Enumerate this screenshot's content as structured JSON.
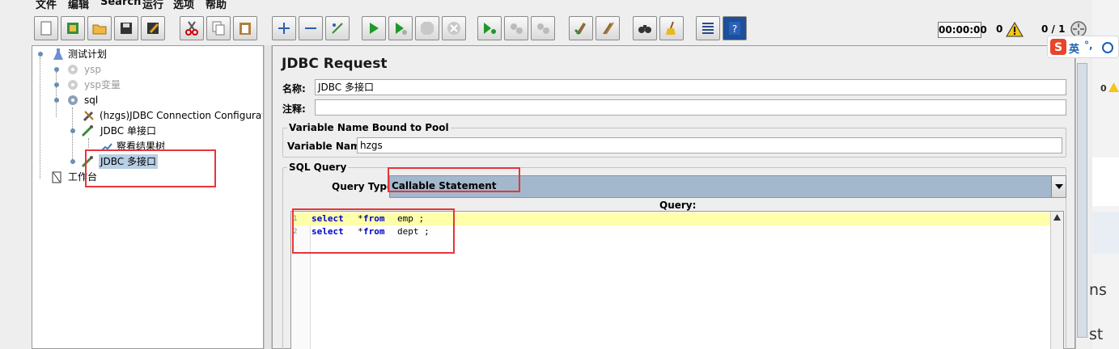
{
  "menu": {
    "items": [
      "文件",
      "编辑",
      "Search",
      "运行",
      "选项",
      "帮助"
    ]
  },
  "toolbar": {
    "icons": [
      "new-icon",
      "templates-icon",
      "open-icon",
      "save-icon",
      "save-as-icon",
      "cut-icon",
      "copy-icon",
      "paste-icon",
      "expand-icon",
      "collapse-icon",
      "toggle-icon",
      "start-icon",
      "start-no-pause-icon",
      "stop-icon",
      "shutdown-icon",
      "remote-start-icon",
      "remote-stop-icon",
      "remote-shutdown-icon",
      "clear-icon",
      "clear-all-icon",
      "search-icon",
      "reset-search-icon",
      "function-helper-icon",
      "help-icon"
    ],
    "timer": "00:00:00",
    "errors": "0",
    "threads": "0 / 1"
  },
  "tree": {
    "test_plan": "测试计划",
    "ysp": "ysp",
    "ysp_var": "ysp变量",
    "sql": "sql",
    "jdbc_config": "(hzgs)JDBC Connection Configuratio",
    "jdbc_single": "JDBC 单接口",
    "view_results": "察看结果树",
    "jdbc_multi": "JDBC 多接口",
    "workbench": "工作台"
  },
  "panel": {
    "title": "JDBC Request",
    "name_label": "名称:",
    "name_value": "JDBC 多接口",
    "comment_label": "注释:",
    "comment_value": "",
    "pool_group": "Variable Name Bound to Pool",
    "var_label": "Variable Name:",
    "var_value": "hzgs",
    "sql_group": "SQL Query",
    "query_type_label": "Query Type:",
    "query_type_value": "Callable Statement",
    "query_label": "Query:",
    "lines": [
      {
        "num": "1",
        "kw1": "select",
        "rest1": "*",
        "kw2": "from",
        "rest2": "emp ;"
      },
      {
        "num": "2",
        "kw1": "select",
        "rest1": "*",
        "kw2": "from",
        "rest2": "dept ;"
      }
    ]
  },
  "strip": {
    "ime_char": "英",
    "ime_punct": "°,",
    "count": "0",
    "text1": "ns",
    "text2": "st"
  },
  "colors": {
    "accent_red": "#e8343a",
    "selection": "#b8cfe5",
    "combo": "#a3b8cc"
  }
}
